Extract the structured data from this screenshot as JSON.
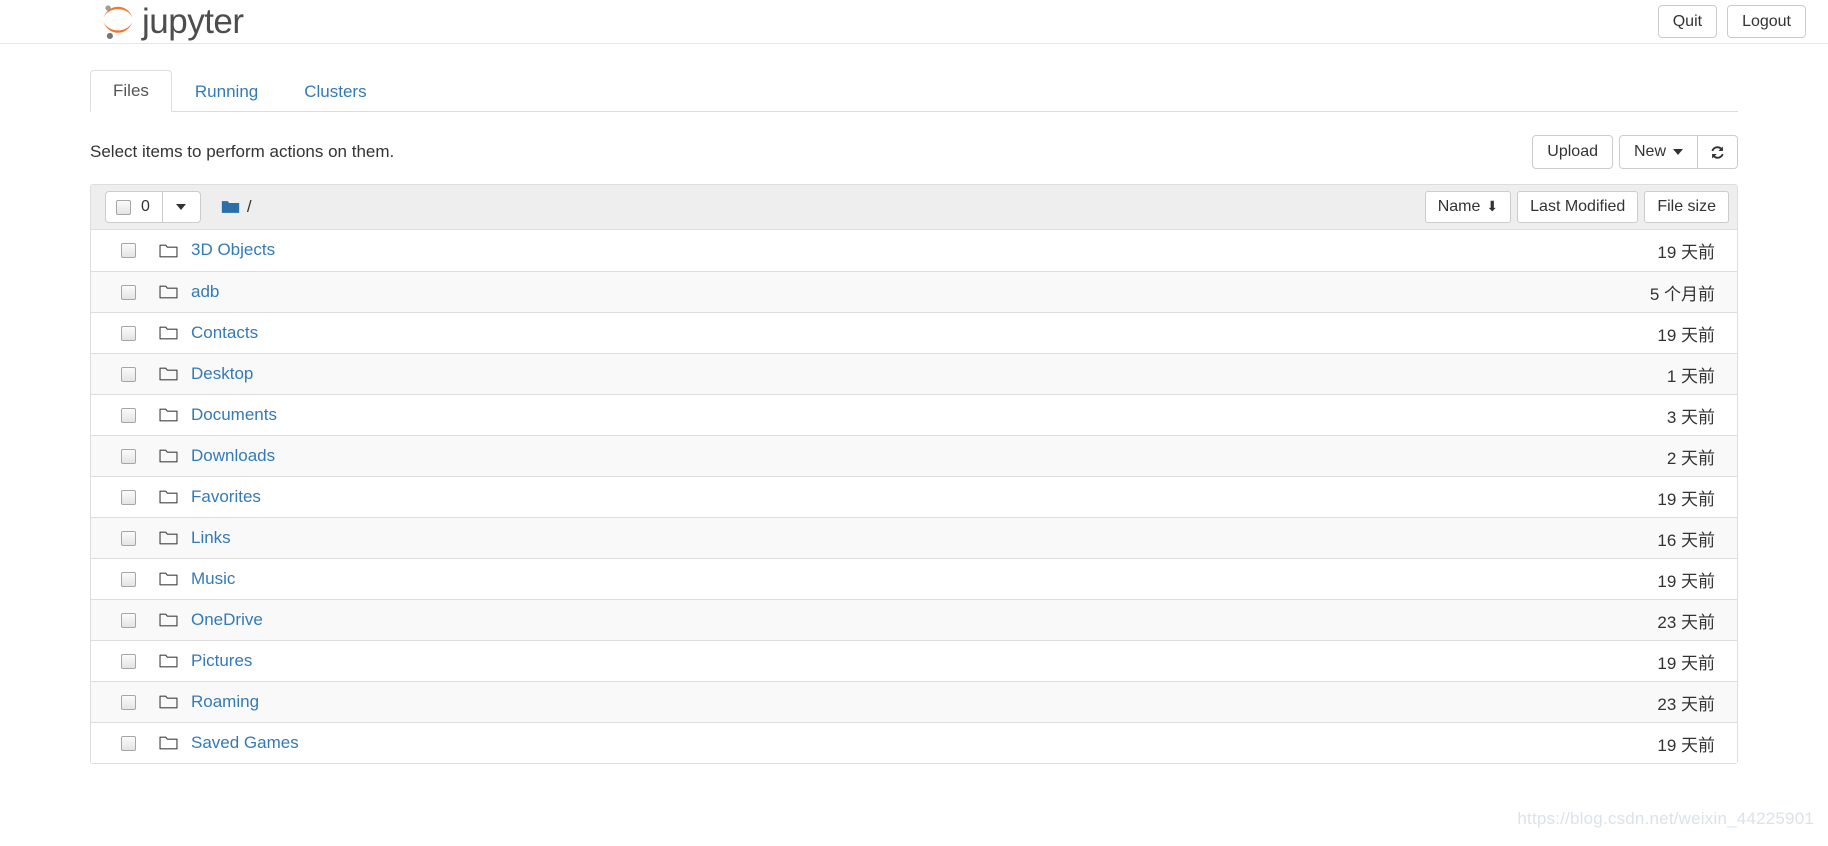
{
  "header": {
    "logo_text": "jupyter",
    "logo_icon": "jupyter-logo-icon",
    "quit_label": "Quit",
    "logout_label": "Logout"
  },
  "tabs": [
    {
      "label": "Files",
      "active": true
    },
    {
      "label": "Running",
      "active": false
    },
    {
      "label": "Clusters",
      "active": false
    }
  ],
  "actions": {
    "note": "Select items to perform actions on them.",
    "upload_label": "Upload",
    "new_label": "New",
    "refresh_icon": "refresh-icon"
  },
  "toolbar": {
    "selected_count": "0",
    "breadcrumb_path": "/",
    "folder_icon": "folder-filled-icon",
    "sort_name_label": "Name",
    "sort_name_arrow": "⬇",
    "sort_modified_label": "Last Modified",
    "sort_size_label": "File size"
  },
  "colors": {
    "link_blue": "#337ab7",
    "logo_orange": "#f37726",
    "logo_gray": "#9e9e9e",
    "toolbar_bg": "#eeeeee",
    "border": "#dddddd",
    "row_alt_bg": "#f9f9f9",
    "text": "#333333",
    "folder_blue": "#2a6fa8"
  },
  "files": [
    {
      "name": "3D Objects",
      "modified": "19 天前",
      "size": "",
      "type": "folder"
    },
    {
      "name": "adb",
      "modified": "5 个月前",
      "size": "",
      "type": "folder"
    },
    {
      "name": "Contacts",
      "modified": "19 天前",
      "size": "",
      "type": "folder"
    },
    {
      "name": "Desktop",
      "modified": "1 天前",
      "size": "",
      "type": "folder"
    },
    {
      "name": "Documents",
      "modified": "3 天前",
      "size": "",
      "type": "folder"
    },
    {
      "name": "Downloads",
      "modified": "2 天前",
      "size": "",
      "type": "folder"
    },
    {
      "name": "Favorites",
      "modified": "19 天前",
      "size": "",
      "type": "folder"
    },
    {
      "name": "Links",
      "modified": "16 天前",
      "size": "",
      "type": "folder"
    },
    {
      "name": "Music",
      "modified": "19 天前",
      "size": "",
      "type": "folder"
    },
    {
      "name": "OneDrive",
      "modified": "23 天前",
      "size": "",
      "type": "folder"
    },
    {
      "name": "Pictures",
      "modified": "19 天前",
      "size": "",
      "type": "folder"
    },
    {
      "name": "Roaming",
      "modified": "23 天前",
      "size": "",
      "type": "folder"
    },
    {
      "name": "Saved Games",
      "modified": "19 天前",
      "size": "",
      "type": "folder"
    }
  ],
  "watermark": "https://blog.csdn.net/weixin_44225901"
}
